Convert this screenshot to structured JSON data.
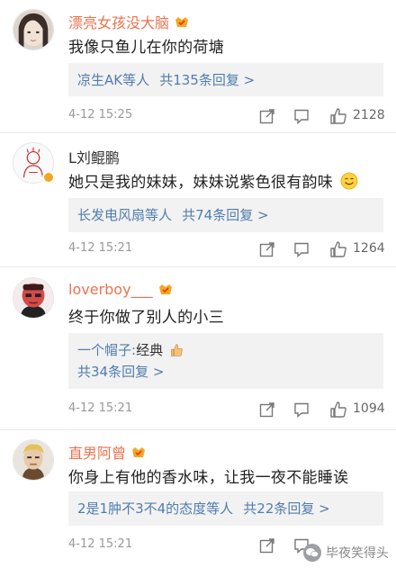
{
  "comments": [
    {
      "name": "漂亮女孩没大脑",
      "text": "我像只鱼儿在你的荷塘",
      "reply_summary": "凉生AK等人",
      "reply_count": "共135条回复 >",
      "time": "4-12 15:25",
      "likes": "2128"
    },
    {
      "name": "L刘鲲鹏",
      "text": "她只是我的妹妹，妹妹说紫色很有韵味",
      "reply_summary": "长发电风扇等人",
      "reply_count": "共74条回复 >",
      "time": "4-12 15:21",
      "likes": "1264"
    },
    {
      "name": "loverboy___",
      "text": "终于你做了别人的小三",
      "reply_user": "一个帽子:",
      "reply_text": "经典",
      "reply_count": "共34条回复 >",
      "time": "4-12 15:21",
      "likes": "1094"
    },
    {
      "name": "直男阿曾",
      "text": "你身上有他的香水味，让我一夜不能睡诶",
      "reply_summary": "2是1肿不3不4的态度等人",
      "reply_count": "共22条回复 >",
      "time": "4-12 15:21",
      "likes": ""
    }
  ],
  "watermark": "毕夜笑得头",
  "colors": {
    "name_accent": "#eb7350",
    "link_blue": "#507daf",
    "reply_bg": "#f2f2f2"
  },
  "icons": [
    "share-icon",
    "comment-icon",
    "like-icon",
    "vip-badge-icon",
    "verified-badge-icon",
    "smile-emoji-icon",
    "thumbs-up-emoji-icon"
  ]
}
